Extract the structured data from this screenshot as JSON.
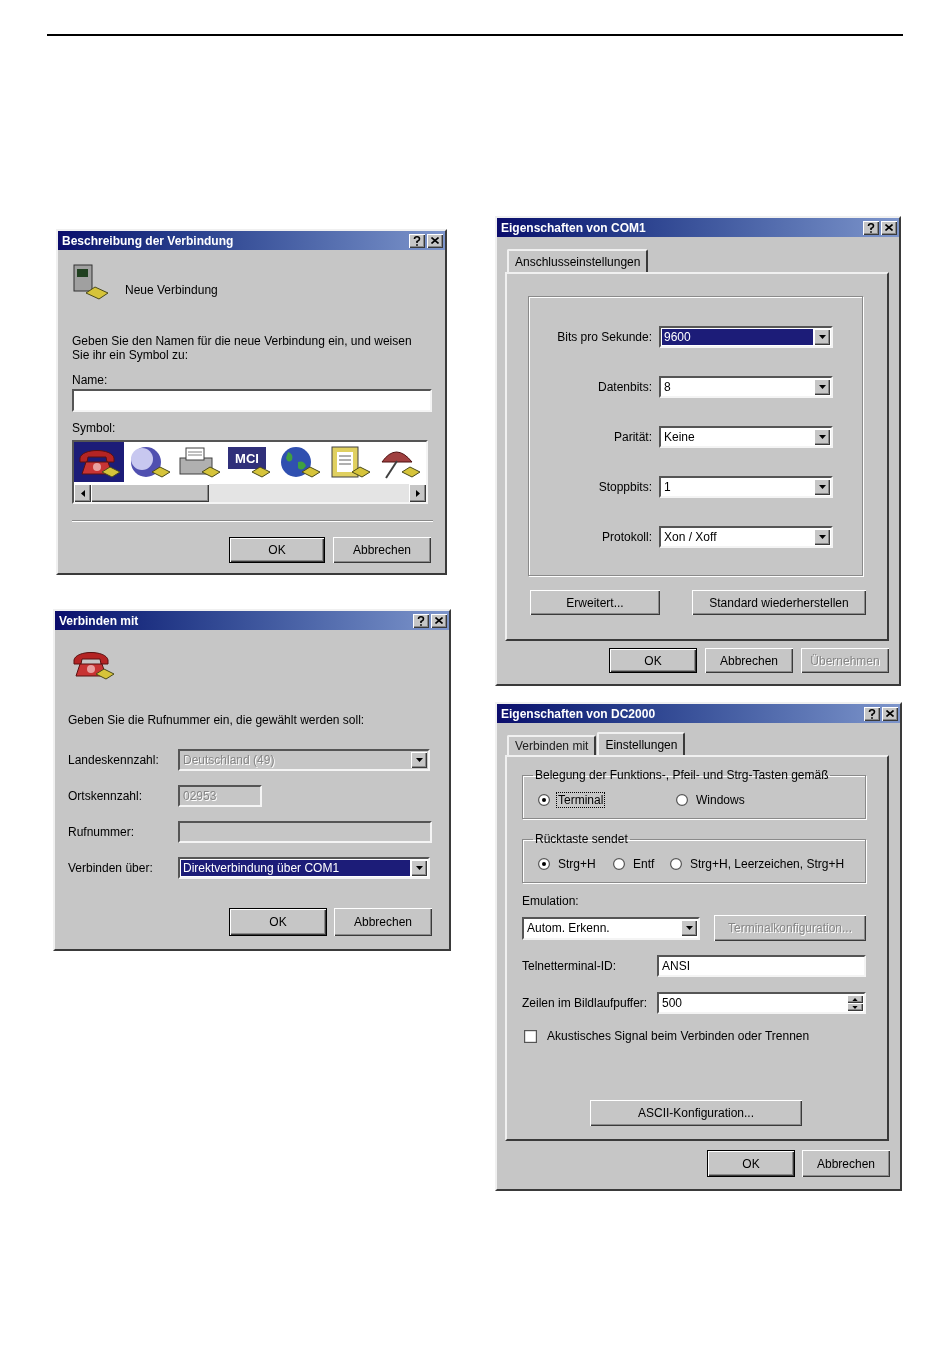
{
  "new_connection_dialog": {
    "title": "Beschreibung der Verbindung",
    "heading": "Neue Verbindung",
    "instruction": "Geben Sie den Namen für die neue Verbindung ein, und weisen Sie ihr ein Symbol zu:",
    "name_label": "Name:",
    "symbol_label": "Symbol:",
    "symbols": [
      {
        "kind": "telephone",
        "selected": true
      },
      {
        "kind": "sphere",
        "selected": false
      },
      {
        "kind": "fax",
        "selected": false
      },
      {
        "kind": "logo",
        "label": "MCI",
        "selected": false
      },
      {
        "kind": "globe",
        "selected": false
      },
      {
        "kind": "notepad",
        "selected": false
      },
      {
        "kind": "umbrella",
        "selected": false
      }
    ],
    "buttons": [
      {
        "label": "OK",
        "default": true
      },
      {
        "label": "Abbrechen",
        "default": false
      }
    ]
  },
  "connect_to_dialog": {
    "title": "Verbinden mit",
    "instruction": "Geben Sie die Rufnummer ein, die gewählt werden soll:",
    "fields": [
      {
        "kind": "dropdown",
        "label": "Landeskennzahl:",
        "value": "Deutschland (49)",
        "disabled": true,
        "focused": false
      },
      {
        "kind": "short_text",
        "label": "Ortskennzahl:",
        "value": "02953",
        "disabled": true,
        "focused": false
      },
      {
        "kind": "text",
        "label": "Rufnummer:",
        "disabled": true,
        "focused": false
      },
      {
        "kind": "dropdown",
        "label": "Verbinden über:",
        "value": "Direktverbindung über COM1",
        "disabled": false,
        "focused": true
      }
    ],
    "buttons": [
      {
        "label": "OK",
        "default": true
      },
      {
        "label": "Abbrechen",
        "default": false
      }
    ]
  },
  "com1_properties_dialog": {
    "title": "Eigenschaften von COM1",
    "tabs": [
      {
        "label": "Anschlusseinstellungen",
        "selected": true
      }
    ],
    "fields": [
      {
        "label": "Bits pro Sekunde:",
        "value": "9600",
        "focused": true
      },
      {
        "label": "Datenbits:",
        "value": "8",
        "focused": false
      },
      {
        "label": "Parität:",
        "value": "Keine",
        "focused": false
      },
      {
        "label": "Stoppbits:",
        "value": "1",
        "focused": false
      },
      {
        "label": "Protokoll:",
        "value": "Xon / Xoff",
        "focused": false
      }
    ],
    "advanced_button": {
      "label": "Erweitert..."
    },
    "restore_button": {
      "label": "Standard wiederherstellen"
    },
    "buttons": [
      {
        "label": "OK",
        "default": true,
        "disabled": false
      },
      {
        "label": "Abbrechen",
        "default": false,
        "disabled": false
      },
      {
        "label": "Übernehmen",
        "default": false,
        "disabled": true
      }
    ]
  },
  "dc2000_properties_dialog": {
    "title": "Eigenschaften von DC2000",
    "tabs": [
      {
        "label": "Verbinden mit",
        "selected": false
      },
      {
        "label": "Einstellungen",
        "selected": true
      }
    ],
    "key_mapping": {
      "legend": "Belegung der Funktions-, Pfeil- und Strg-Tasten gemäß",
      "options": [
        {
          "label": "Terminal",
          "selected": true,
          "focused": true
        },
        {
          "label": "Windows",
          "selected": false,
          "focused": false
        }
      ]
    },
    "backspace": {
      "legend": "Rücktaste sendet",
      "options": [
        {
          "label": "Strg+H",
          "selected": true
        },
        {
          "label": "Entf",
          "selected": false
        },
        {
          "label": "Strg+H, Leerzeichen, Strg+H",
          "selected": false
        }
      ]
    },
    "emulation": {
      "label": "Emulation:",
      "value": "Autom. Erkenn."
    },
    "terminal_config_button": {
      "label": "Terminalkonfiguration...",
      "disabled": true
    },
    "telnet_id": {
      "label": "Telnetterminal-ID:",
      "value": "ANSI"
    },
    "scrollback": {
      "label": "Zeilen im Bildlaufpuffer:",
      "value": "500"
    },
    "sound": {
      "label": "Akustisches Signal beim Verbinden oder Trennen",
      "checked": false
    },
    "ascii_button": {
      "label": "ASCII-Konfiguration..."
    },
    "buttons": [
      {
        "label": "OK",
        "default": true
      },
      {
        "label": "Abbrechen",
        "default": false
      }
    ]
  }
}
